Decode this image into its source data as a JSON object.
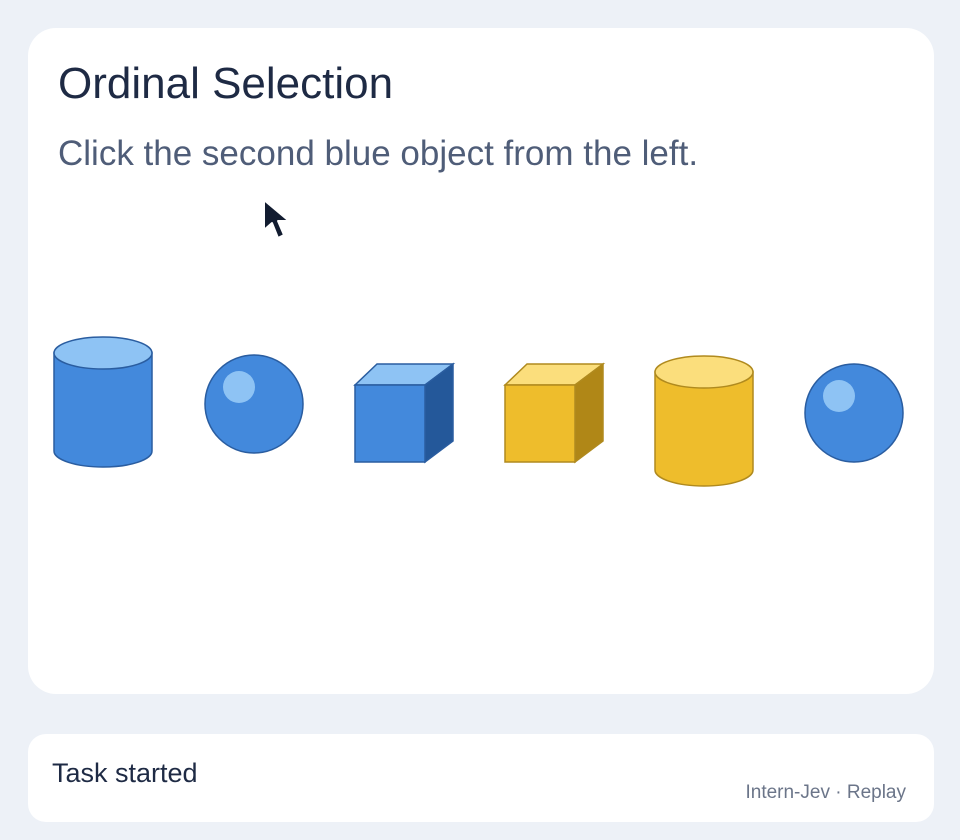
{
  "task": {
    "title": "Ordinal Selection",
    "instruction": "Click the second blue object from the left."
  },
  "objects": [
    {
      "shape": "cylinder",
      "color": "blue"
    },
    {
      "shape": "sphere",
      "color": "blue"
    },
    {
      "shape": "cube",
      "color": "blue"
    },
    {
      "shape": "cube",
      "color": "yellow"
    },
    {
      "shape": "cylinder",
      "color": "yellow"
    },
    {
      "shape": "sphere",
      "color": "blue"
    }
  ],
  "colors": {
    "blue": {
      "fill": "#4389dc",
      "light": "#8ec3f4",
      "dark": "#24589a",
      "stroke": "#2a5da0"
    },
    "yellow": {
      "fill": "#eebd2c",
      "light": "#fbde7c",
      "dark": "#b08717",
      "stroke": "#b08a1e"
    },
    "background": "#edf1f7",
    "card": "#ffffff"
  },
  "status": {
    "text": "Task started"
  },
  "footer": {
    "author": "Intern-Jev",
    "separator": "·",
    "replay_label": "Replay"
  }
}
